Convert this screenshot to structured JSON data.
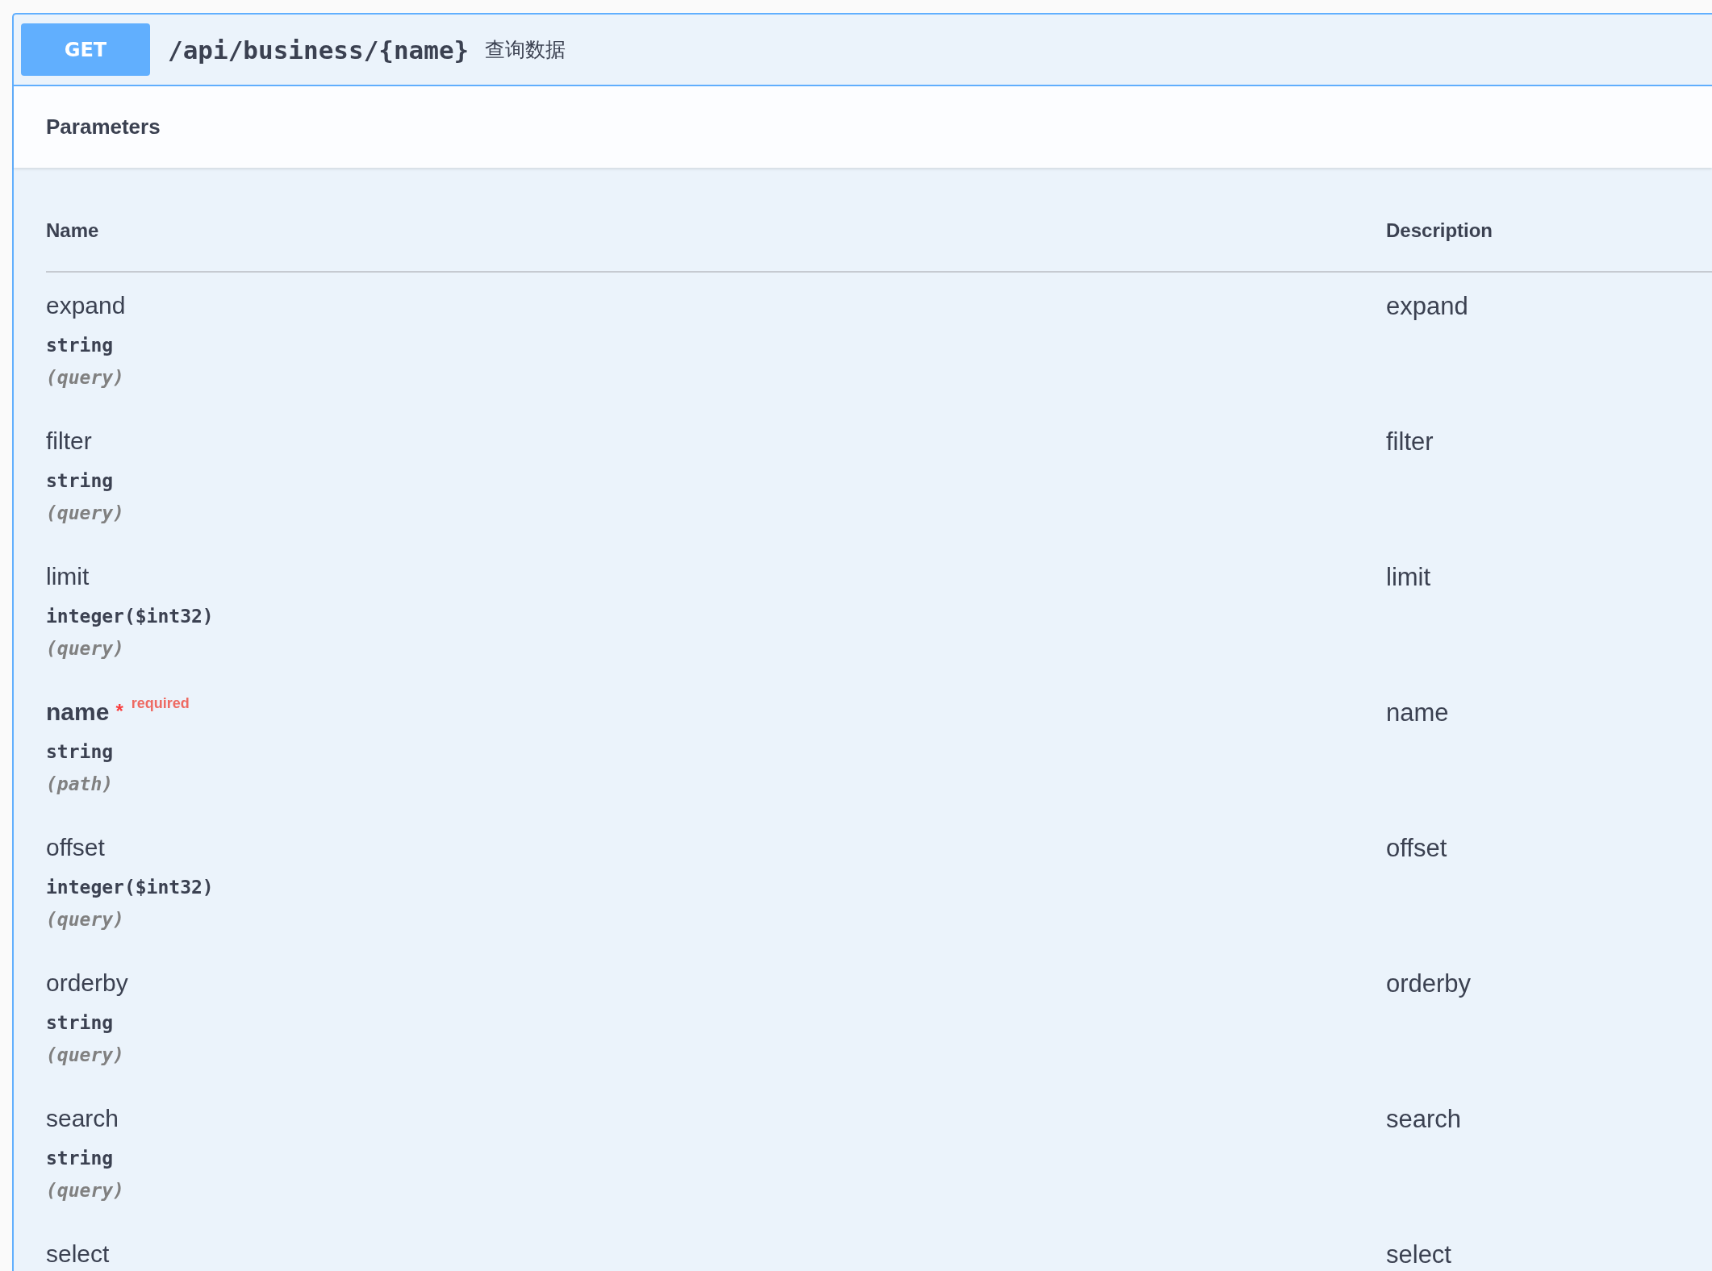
{
  "operation": {
    "method": "GET",
    "path": "/api/business/{name}",
    "summary": "查询数据"
  },
  "parameters_title": "Parameters",
  "table": {
    "columns": [
      "Name",
      "Description"
    ],
    "rows": [
      {
        "name": "expand",
        "type": "string",
        "location": "(query)",
        "description": "expand",
        "required": false
      },
      {
        "name": "filter",
        "type": "string",
        "location": "(query)",
        "description": "filter",
        "required": false
      },
      {
        "name": "limit",
        "type": "integer($int32)",
        "location": "(query)",
        "description": "limit",
        "required": false
      },
      {
        "name": "name",
        "type": "string",
        "location": "(path)",
        "description": "name",
        "required": true,
        "required_mark": "*",
        "required_label": "required"
      },
      {
        "name": "offset",
        "type": "integer($int32)",
        "location": "(query)",
        "description": "offset",
        "required": false
      },
      {
        "name": "orderby",
        "type": "string",
        "location": "(query)",
        "description": "orderby",
        "required": false
      },
      {
        "name": "search",
        "type": "string",
        "location": "(query)",
        "description": "search",
        "required": false
      },
      {
        "name": "select",
        "description": "select",
        "required": false
      }
    ]
  }
}
